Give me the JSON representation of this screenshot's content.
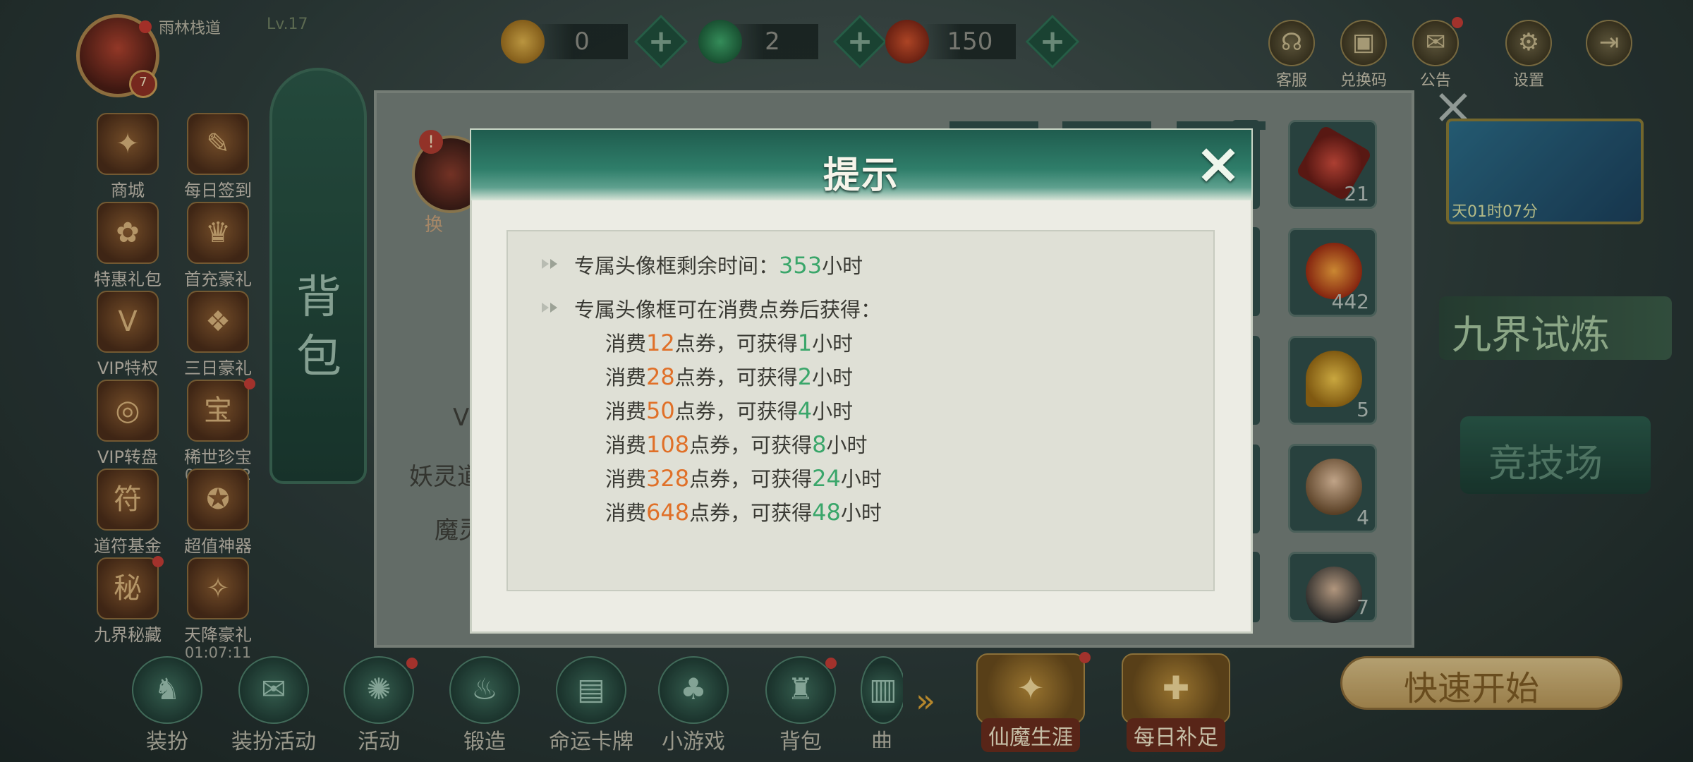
{
  "player": {
    "name": "雨林栈道",
    "level": "Lv.17",
    "badge": "7"
  },
  "currencies": [
    {
      "icon": "coin-icon",
      "value": "0"
    },
    {
      "icon": "jade-dragon-icon",
      "value": "2"
    },
    {
      "icon": "voucher-icon",
      "value": "150"
    }
  ],
  "top_buttons": [
    {
      "label": "客服",
      "icon": "headset-icon",
      "glyph": "☊"
    },
    {
      "label": "兑换码",
      "icon": "gift-code-icon",
      "glyph": "▣"
    },
    {
      "label": "公告",
      "icon": "megaphone-icon",
      "glyph": "✉"
    },
    {
      "label": "设置",
      "icon": "gear-icon",
      "glyph": "⚙"
    },
    {
      "label": "",
      "icon": "exit-icon",
      "glyph": "⇥"
    }
  ],
  "left_menu": [
    {
      "label": "商城",
      "glyph": "✦",
      "timer": ""
    },
    {
      "label": "每日签到",
      "glyph": "✎",
      "timer": ""
    },
    {
      "label": "特惠礼包",
      "glyph": "✿",
      "timer": ""
    },
    {
      "label": "首充豪礼",
      "glyph": "♛",
      "timer": ""
    },
    {
      "label": "VIP特权",
      "glyph": "V",
      "timer": ""
    },
    {
      "label": "三日豪礼",
      "glyph": "❖",
      "timer": ""
    },
    {
      "label": "VIP转盘",
      "glyph": "◎",
      "timer": ""
    },
    {
      "label": "稀世珍宝",
      "glyph": "宝",
      "timer": "00:57:42"
    },
    {
      "label": "道符基金",
      "glyph": "符",
      "timer": ""
    },
    {
      "label": "超值神器",
      "glyph": "✪",
      "timer": ""
    },
    {
      "label": "九界秘藏",
      "glyph": "秘",
      "timer": ""
    },
    {
      "label": "天降豪礼",
      "glyph": "✧",
      "timer": "01:07:11"
    }
  ],
  "backpack": {
    "title": "背包",
    "slots": [
      {
        "count": "21",
        "color": "#b0302a"
      },
      {
        "count": "442",
        "color": "#d04a1a"
      },
      {
        "count": "5",
        "color": "#d9a02a"
      },
      {
        "count": "4",
        "color": "#c79a6a"
      },
      {
        "count": "7",
        "color": "#3a3a3a"
      }
    ],
    "faded_labels": [
      "V",
      "妖灵道",
      "魔灵"
    ],
    "faded_partial": "换"
  },
  "right_panel": {
    "event_timer": "天01时07分",
    "jiujie": "九界试炼",
    "arena": "竞技场",
    "quick_start": "快速开始"
  },
  "bottom_menu": [
    {
      "label": "装扮",
      "glyph": "♞"
    },
    {
      "label": "装扮活动",
      "glyph": "✉"
    },
    {
      "label": "活动",
      "glyph": "✺"
    },
    {
      "label": "锻造",
      "glyph": "♨"
    },
    {
      "label": "命运卡牌",
      "glyph": "▤"
    },
    {
      "label": "小游戏",
      "glyph": "♣"
    },
    {
      "label": "背包",
      "glyph": "♜"
    },
    {
      "label": "曲",
      "glyph": "▥"
    }
  ],
  "bottom_big": [
    {
      "label": "仙魔生涯",
      "glyph": "✦"
    },
    {
      "label": "每日补足",
      "glyph": "✚"
    }
  ],
  "dialog": {
    "title": "提示",
    "remaining_label": "专属头像框剩余时间：",
    "remaining_value": "353",
    "remaining_unit": "小时",
    "obtain_label": "专属头像框可在消费点券后获得：",
    "spend_prefix": "消费",
    "spend_unit": "点券，可获得",
    "hours_unit": "小时",
    "tiers": [
      {
        "cost": "12",
        "hours": "1"
      },
      {
        "cost": "28",
        "hours": "2"
      },
      {
        "cost": "50",
        "hours": "4"
      },
      {
        "cost": "108",
        "hours": "8"
      },
      {
        "cost": "328",
        "hours": "24"
      },
      {
        "cost": "648",
        "hours": "48"
      }
    ]
  },
  "colors": {
    "cost": "#e07028",
    "hours": "#3aa66a",
    "header": "#2f7e6a"
  }
}
